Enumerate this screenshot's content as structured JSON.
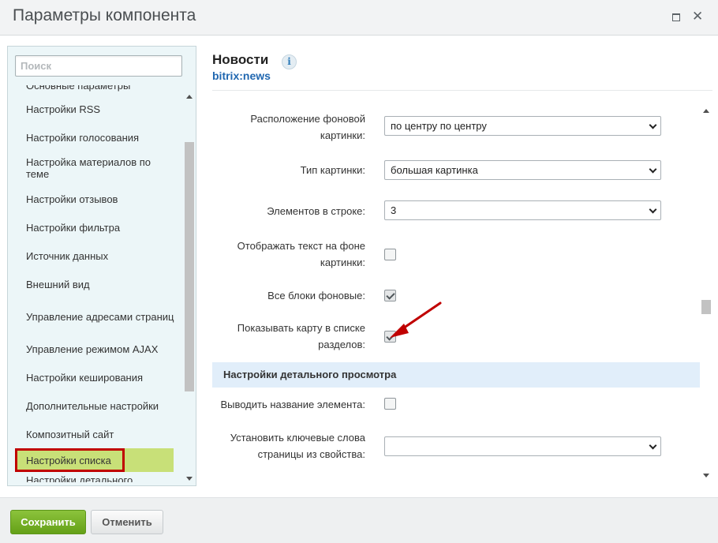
{
  "window": {
    "title": "Параметры компонента"
  },
  "sidebar": {
    "search_placeholder": "Поиск",
    "items": [
      {
        "label": "Основные параметры"
      },
      {
        "label": "Настройки RSS"
      },
      {
        "label": "Настройки голосования"
      },
      {
        "label": "Настройка материалов по теме"
      },
      {
        "label": "Настройки отзывов"
      },
      {
        "label": "Настройки фильтра"
      },
      {
        "label": "Источник данных"
      },
      {
        "label": "Внешний вид"
      },
      {
        "label": "Управление адресами страниц"
      },
      {
        "label": "Управление режимом AJAX"
      },
      {
        "label": "Настройки кеширования"
      },
      {
        "label": "Дополнительные настройки"
      },
      {
        "label": "Композитный сайт"
      },
      {
        "label": "Настройки списка",
        "active": true
      },
      {
        "label": "Настройки детального просмотра"
      }
    ]
  },
  "component": {
    "name": "Новости",
    "code": "bitrix:news",
    "info_icon": "info-icon"
  },
  "settings": {
    "background_position": {
      "label": "Расположение фоновой картинки:",
      "value": "по центру по центру"
    },
    "picture_type": {
      "label": "Тип картинки:",
      "value": "большая картинка"
    },
    "elements_per_row": {
      "label": "Элементов в строке:",
      "value": "3"
    },
    "show_text_on_bg": {
      "label": "Отображать текст на фоне картинки:",
      "checked": false
    },
    "all_blocks_bg": {
      "label": "Все блоки фоновые:",
      "checked": true
    },
    "show_map_in_sections": {
      "label": "Показывать карту в списке разделов:",
      "checked": true
    }
  },
  "detail_section": {
    "title": "Настройки детального просмотра",
    "show_element_name": {
      "label": "Выводить название элемента:",
      "checked": false
    },
    "meta_keywords": {
      "label": "Установить ключевые слова страницы из свойства:",
      "value": ""
    }
  },
  "footer": {
    "save_label": "Сохранить",
    "cancel_label": "Отменить"
  },
  "colors": {
    "save_button": "#71a81b",
    "active_item": "#c8e078",
    "highlight_frame": "#c00000",
    "section_header": "#e1eefa"
  }
}
